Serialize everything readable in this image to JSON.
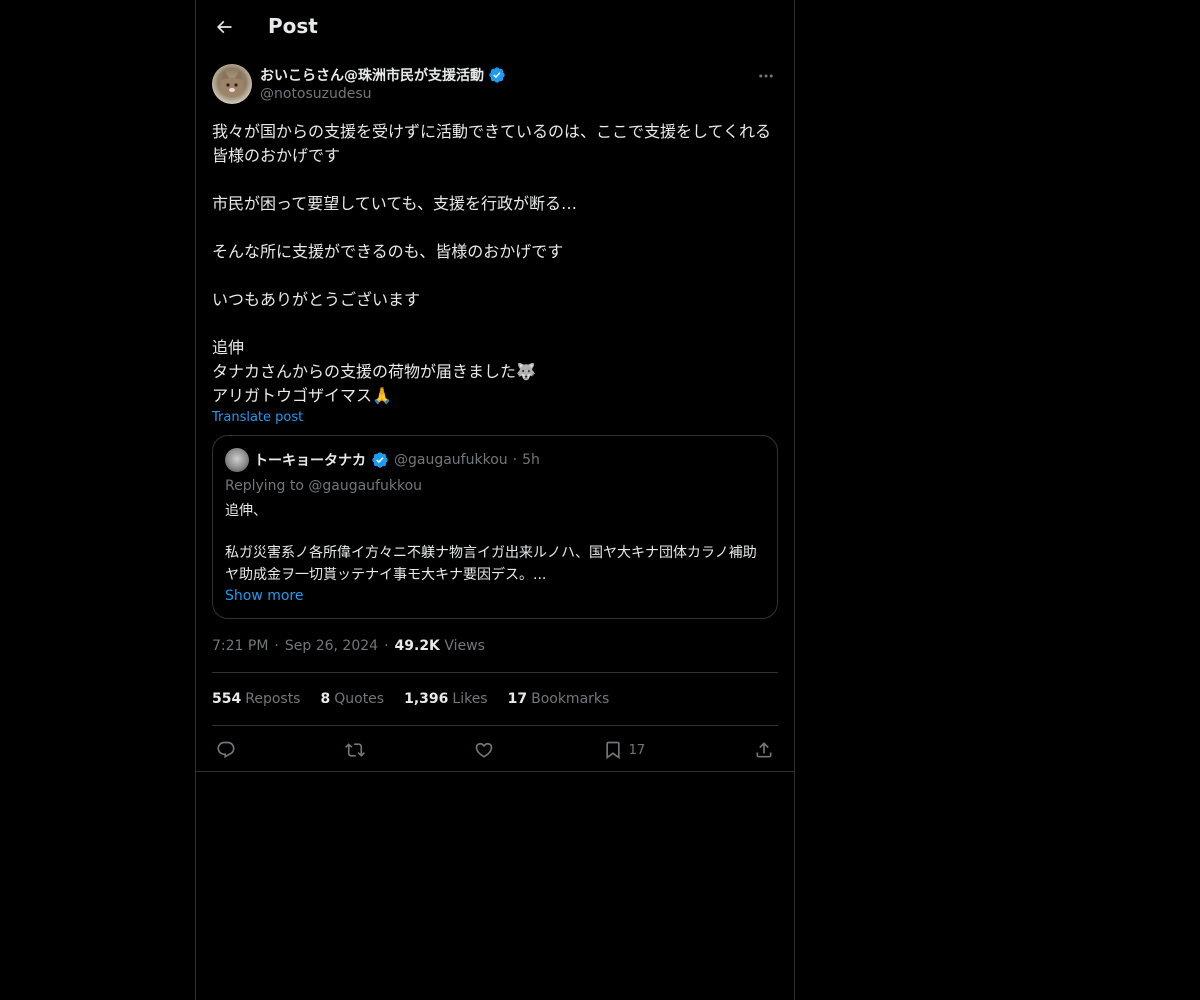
{
  "header": {
    "title": "Post",
    "back_icon": "arrow-left-icon"
  },
  "author": {
    "display_name": "おいこらさん@珠洲市民が支援活動",
    "handle": "@notosuzudesu",
    "verified": true
  },
  "post": {
    "paragraphs": [
      "我々が国からの支援を受けずに活動できているのは、ここで支援をしてくれる皆様のおかげです",
      "",
      "市民が困って要望していても、支援を行政が断る…",
      "",
      "そんな所に支援ができるのも、皆様のおかげです",
      "",
      "いつもありがとうございます",
      "",
      "追伸",
      "タナカさんからの支援の荷物が届きました🐺",
      "アリガトウゴザイマス🙏"
    ],
    "translate_label": "Translate post"
  },
  "quote": {
    "display_name": "トーキョータナカ",
    "handle": "@gaugaufukkou",
    "separator": "·",
    "time": "5h",
    "replying_to": "Replying to @gaugaufukkou",
    "paragraphs": [
      "追伸、",
      "",
      "私ガ災害系ノ各所偉イ方々ニ不躾ナ物言イガ出来ルノハ、国ヤ大キナ団体カラノ補助ヤ助成金ヲ一切貰ッテナイ事モ大キナ要因デス。..."
    ],
    "show_more": "Show more"
  },
  "meta": {
    "time": "7:21 PM",
    "sep1": "·",
    "date": "Sep 26, 2024",
    "sep2": "·",
    "views_count": "49.2K",
    "views_label": "Views"
  },
  "stats": {
    "reposts": {
      "count": "554",
      "label": "Reposts"
    },
    "quotes": {
      "count": "8",
      "label": "Quotes"
    },
    "likes": {
      "count": "1,396",
      "label": "Likes"
    },
    "bookmarks": {
      "count": "17",
      "label": "Bookmarks"
    }
  },
  "actions": {
    "reply_icon": "reply-icon",
    "repost_icon": "repost-icon",
    "like_icon": "heart-icon",
    "bookmark_icon": "bookmark-icon",
    "bookmark_count": "17",
    "share_icon": "share-icon"
  },
  "colors": {
    "background": "#000000",
    "accent": "#1d9bf0",
    "text": "#e7e9ea",
    "muted": "#71767b",
    "border": "#2f3336"
  }
}
